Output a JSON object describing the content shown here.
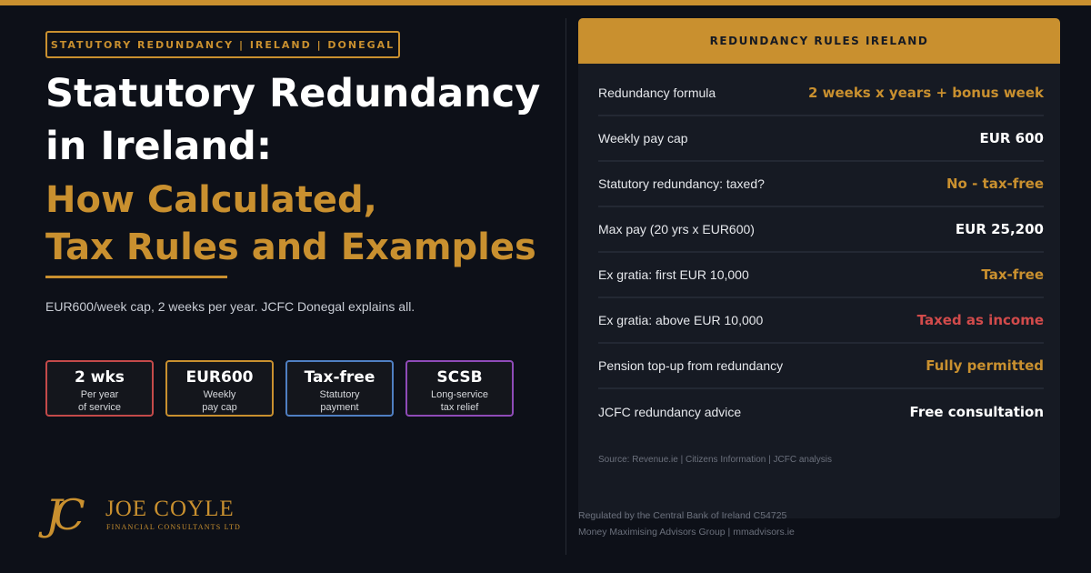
{
  "tag": "STATUTORY REDUNDANCY | IRELAND | DONEGAL",
  "title_lines": [
    "Statutory Redundancy",
    "in Ireland:"
  ],
  "subtitle_lines": [
    "How Calculated,",
    "Tax Rules and Examples"
  ],
  "lead": "EUR600/week cap, 2 weeks per year. JCFC Donegal explains all.",
  "stats": [
    {
      "value": "2 wks",
      "label_1": "Per year",
      "label_2": "of service",
      "color": "#c44a4a"
    },
    {
      "value": "EUR600",
      "label_1": "Weekly",
      "label_2": "pay cap",
      "color": "#c9902f"
    },
    {
      "value": "Tax-free",
      "label_1": "Statutory",
      "label_2": "payment",
      "color": "#4f7fc2"
    },
    {
      "value": "SCSB",
      "label_1": "Long-service",
      "label_2": "tax relief",
      "color": "#8f4bb8"
    }
  ],
  "logo": {
    "mark": "JC",
    "name": "JOE COYLE",
    "sub": "FINANCIAL CONSULTANTS LTD"
  },
  "panel": {
    "heading": "REDUNDANCY RULES IRELAND",
    "rows": [
      {
        "key": "Redundancy formula",
        "value": "2 weeks x years + bonus week",
        "color": "#c9902f"
      },
      {
        "key": "Weekly pay cap",
        "value": "EUR 600",
        "color": "#ffffff"
      },
      {
        "key": "Statutory redundancy: taxed?",
        "value": "No - tax-free",
        "color": "#c9902f"
      },
      {
        "key": "Max pay (20 yrs x EUR600)",
        "value": "EUR 25,200",
        "color": "#ffffff"
      },
      {
        "key": "Ex gratia: first EUR 10,000",
        "value": "Tax-free",
        "color": "#c9902f"
      },
      {
        "key": "Ex gratia: above EUR 10,000",
        "value": "Taxed as income",
        "color": "#d24b4b"
      },
      {
        "key": "Pension top-up from redundancy",
        "value": "Fully permitted",
        "color": "#c9902f"
      },
      {
        "key": "JCFC redundancy advice",
        "value": "Free consultation",
        "color": "#ffffff"
      }
    ],
    "source": "Source: Revenue.ie | Citizens Information | JCFC analysis"
  },
  "regulation_lines": [
    "Regulated by the Central Bank of Ireland C54725",
    "Money Maximising Advisors Group | mmadvisors.ie"
  ]
}
